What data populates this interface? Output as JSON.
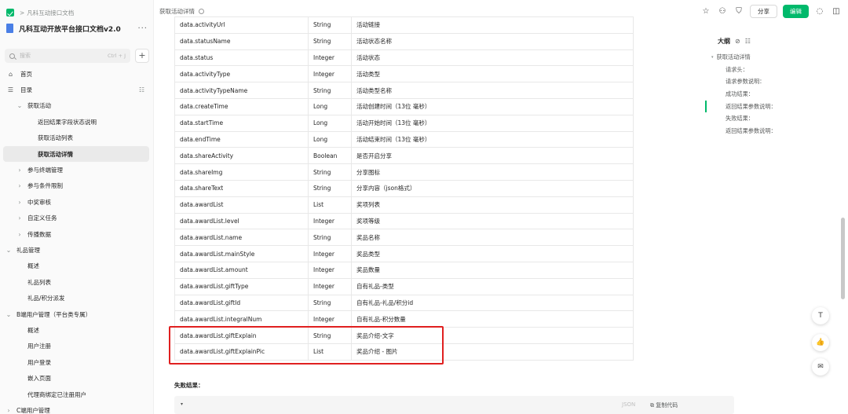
{
  "breadcrumb": {
    "parent": "凡科互动接口文档"
  },
  "book": {
    "title": "凡科互动开放平台接口文档v2.0",
    "more": "···"
  },
  "search": {
    "placeholder": "搜索",
    "shortcut": "Ctrl + J",
    "add": "+"
  },
  "nav": {
    "home": "首页",
    "catalog": "目录",
    "items": [
      {
        "label": "获取活动",
        "level": 1,
        "expanded": true
      },
      {
        "label": "返回结果字段状态说明",
        "level": 2
      },
      {
        "label": "获取活动列表",
        "level": 2
      },
      {
        "label": "获取活动详情",
        "level": 2,
        "active": true
      },
      {
        "label": "参与终端管理",
        "level": 1
      },
      {
        "label": "参与条件限制",
        "level": 1
      },
      {
        "label": "中奖审核",
        "level": 1
      },
      {
        "label": "自定义任务",
        "level": 1
      },
      {
        "label": "传播数据",
        "level": 1
      },
      {
        "label": "礼品管理",
        "level": 0,
        "expanded": true
      },
      {
        "label": "概述",
        "level": 1
      },
      {
        "label": "礼品列表",
        "level": 1
      },
      {
        "label": "礼品/积分派发",
        "level": 1
      },
      {
        "label": "B端用户管理（平台类专属）",
        "level": 0,
        "expanded": true
      },
      {
        "label": "概述",
        "level": 1
      },
      {
        "label": "用户注册",
        "level": 1
      },
      {
        "label": "用户登录",
        "level": 1
      },
      {
        "label": "嵌入页面",
        "level": 1
      },
      {
        "label": "代理商绑定已注册用户",
        "level": 1
      },
      {
        "label": "C端用户管理",
        "level": 0
      }
    ]
  },
  "header": {
    "doc_title": "获取活动详情",
    "share": "分享",
    "edit": "编辑"
  },
  "table": {
    "rows": [
      [
        "data.activityUrl",
        "String",
        "活动链接"
      ],
      [
        "data.statusName",
        "String",
        "活动状态名称"
      ],
      [
        "data.status",
        "Integer",
        "活动状态"
      ],
      [
        "data.activityType",
        "Integer",
        "活动类型"
      ],
      [
        "data.activityTypeName",
        "String",
        "活动类型名称"
      ],
      [
        "data.createTime",
        "Long",
        "活动创建时间（13位 毫秒）"
      ],
      [
        "data.startTime",
        "Long",
        "活动开始时间（13位 毫秒）"
      ],
      [
        "data.endTime",
        "Long",
        "活动结束时间（13位 毫秒）"
      ],
      [
        "data.shareActivity",
        "Boolean",
        "是否开启分享"
      ],
      [
        "data.shareImg",
        "String",
        "分享图标"
      ],
      [
        "data.shareText",
        "String",
        "分享内容（json格式）"
      ],
      [
        "data.awardList",
        "List",
        "奖项列表"
      ],
      [
        "data.awardList.level",
        "Integer",
        "奖项等级"
      ],
      [
        "data.awardList.name",
        "String",
        "奖品名称"
      ],
      [
        "data.awardList.mainStyle",
        "Integer",
        "奖品类型"
      ],
      [
        "data.awardList.amount",
        "Integer",
        "奖品数量"
      ],
      [
        "data.awardList.giftType",
        "Integer",
        "自有礼品-类型"
      ],
      [
        "data.awardList.giftId",
        "String",
        "自有礼品-礼品/积分id"
      ],
      [
        "data.awardList.integralNum",
        "Integer",
        "自有礼品-积分数量"
      ],
      [
        "data.awardList.giftExplain",
        "String",
        "奖品介绍-文字"
      ],
      [
        "data.awardList.giftExplainPic",
        "List",
        "奖品介绍 - 图片"
      ]
    ]
  },
  "fail_section": {
    "title": "失败结果：",
    "lang": "JSON",
    "copy": "复制代码"
  },
  "toc": {
    "title": "大纲",
    "items": [
      {
        "label": "获取活动详情",
        "level": 0
      },
      {
        "label": "请求头：",
        "level": 1
      },
      {
        "label": "请求参数说明：",
        "level": 1
      },
      {
        "label": "成功结果：",
        "level": 1
      },
      {
        "label": "返回结果参数说明：",
        "level": 1,
        "active": true
      },
      {
        "label": "失败结果：",
        "level": 1
      },
      {
        "label": "返回结果参数说明：",
        "level": 1
      }
    ]
  },
  "colors": {
    "accent": "#00b96b",
    "highlight": "#e02020"
  }
}
